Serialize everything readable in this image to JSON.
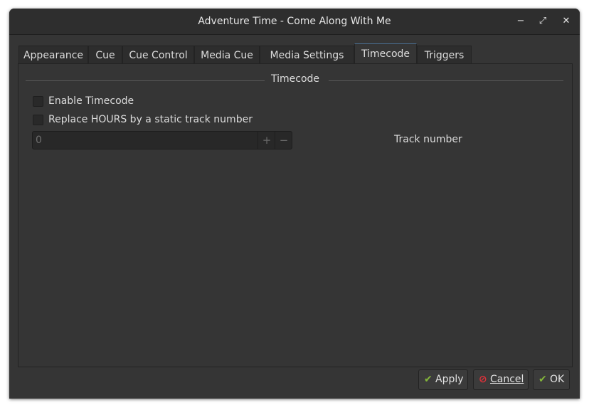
{
  "window": {
    "title": "Adventure Time - Come Along With Me",
    "controls": {
      "minimize": "−",
      "maximize": "⤢",
      "close": "✕"
    }
  },
  "tabs": [
    {
      "label": "Appearance",
      "active": false
    },
    {
      "label": "Cue",
      "active": false
    },
    {
      "label": "Cue Control",
      "active": false
    },
    {
      "label": "Media Cue",
      "active": false
    },
    {
      "label": "Media Settings",
      "active": false
    },
    {
      "label": "Timecode",
      "active": true
    },
    {
      "label": "Triggers",
      "active": false
    }
  ],
  "timecode": {
    "group_title": "Timecode",
    "enable_label": "Enable Timecode",
    "enable_checked": false,
    "replace_hours_label": "Replace HOURS by a static track number",
    "replace_hours_checked": false,
    "track_value": "0",
    "track_label": "Track number",
    "plus": "+",
    "minus": "−"
  },
  "buttons": {
    "apply": {
      "icon": "checkmark-icon",
      "label": "Apply"
    },
    "cancel": {
      "icon": "cancel-icon",
      "label": "Cancel"
    },
    "ok": {
      "icon": "checkmark-icon",
      "label": "OK"
    }
  },
  "colors": {
    "background": "#353535",
    "accent_active_tab": "#4a6f93",
    "ok_icon": "#84b63a",
    "cancel_icon": "#d8323a"
  }
}
